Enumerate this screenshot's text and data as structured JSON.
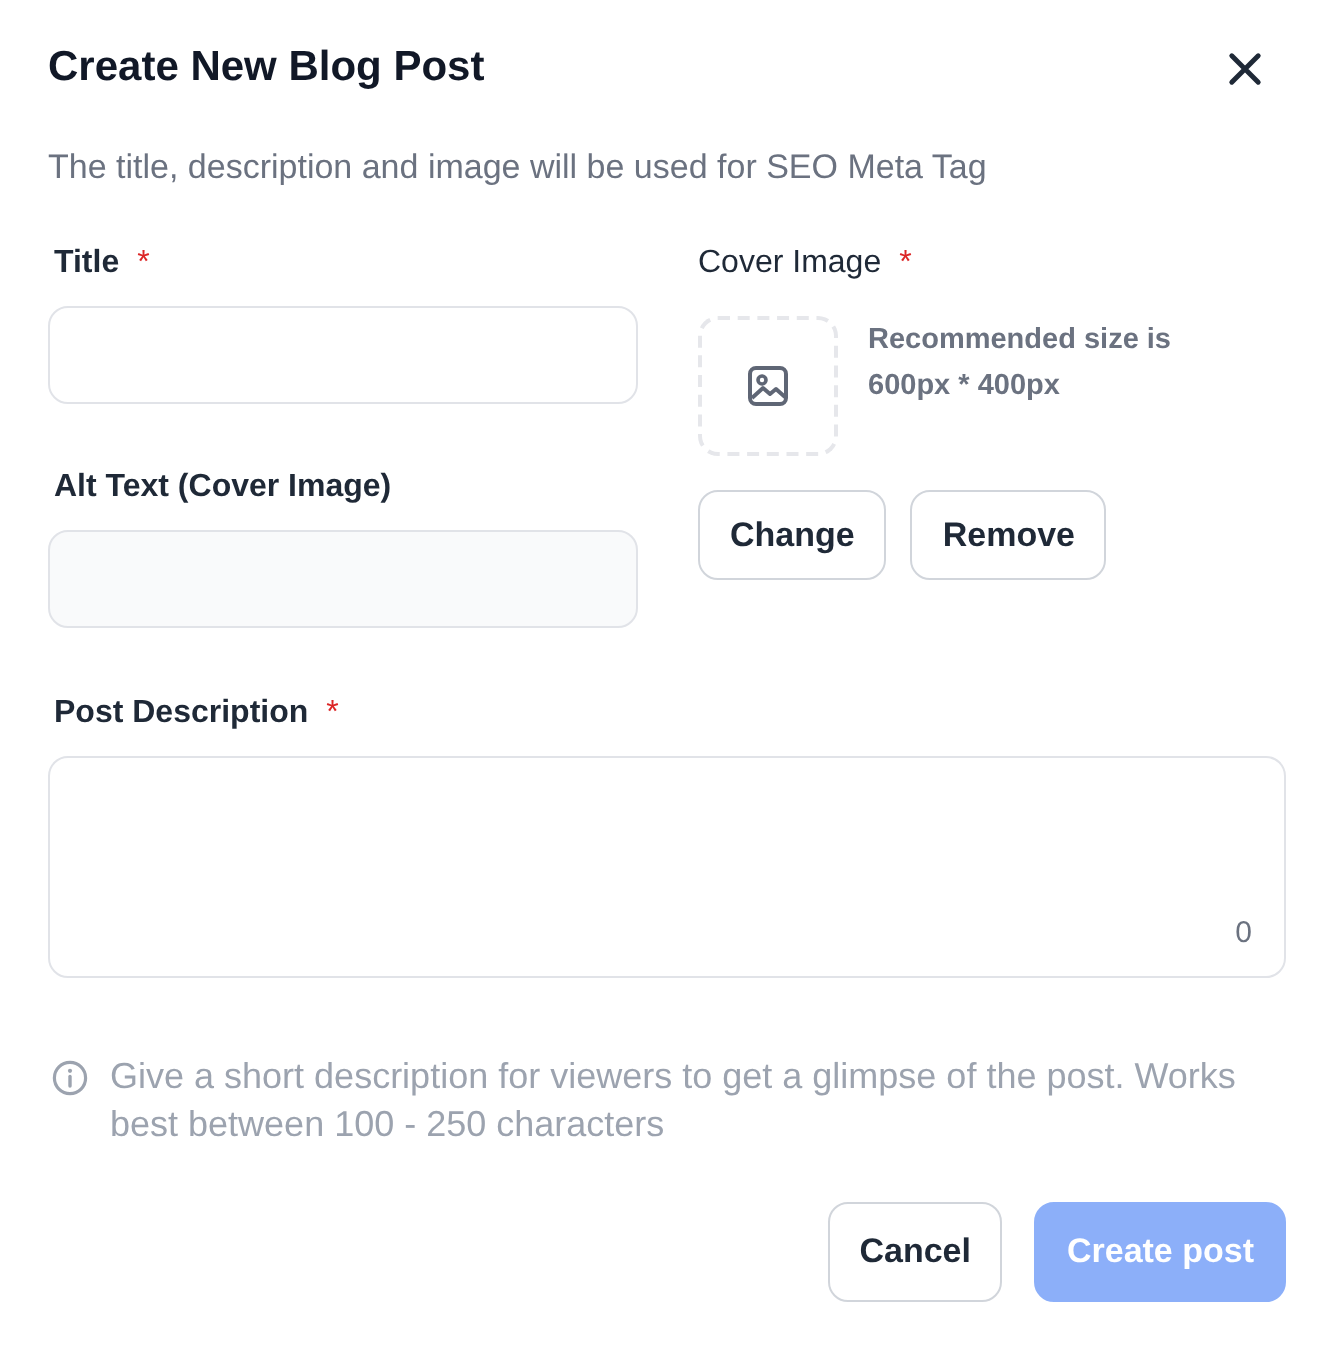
{
  "dialog": {
    "title": "Create New Blog Post",
    "subtitle": "The title, description and image will be used for SEO Meta Tag"
  },
  "title_field": {
    "label": "Title",
    "required_mark": "*"
  },
  "alt_text_field": {
    "label": "Alt Text (Cover Image)"
  },
  "cover_image": {
    "label": "Cover Image",
    "required_mark": "*",
    "hint": "Recommended size is 600px * 400px",
    "buttons": [
      {
        "label": "Change"
      },
      {
        "label": "Remove"
      }
    ]
  },
  "description_field": {
    "label": "Post Description",
    "required_mark": "*",
    "counter": "0"
  },
  "help_text": "Give a short description for viewers to get a glimpse of the post. Works best between 100 - 250 characters",
  "footer_buttons": [
    {
      "label": "Cancel",
      "kind": "secondary",
      "disabled": false
    },
    {
      "label": "Create post",
      "kind": "primary",
      "disabled": true
    }
  ]
}
